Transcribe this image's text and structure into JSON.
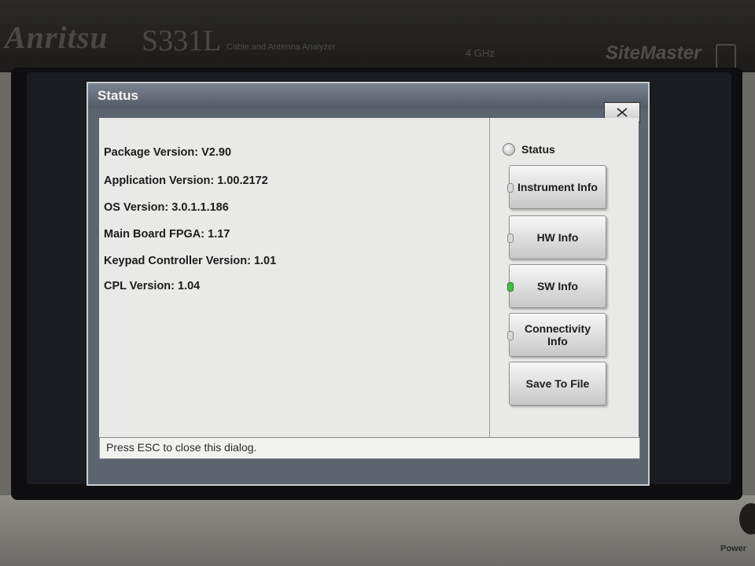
{
  "device": {
    "brand": "Anritsu",
    "model": "S331L",
    "model_description": "Cable and Antenna Analyzer",
    "frequency": "4 GHz",
    "product_name": "SiteMaster",
    "power_label": "Power"
  },
  "dialog": {
    "title": "Status",
    "close_icon": "close-icon",
    "info_lines": [
      {
        "label": "Package Version:",
        "value": "V2.90"
      },
      {
        "label": "Application Version:",
        "value": "1.00.2172"
      },
      {
        "label": "OS Version:",
        "value": "3.0.1.1.186"
      },
      {
        "label": "Main Board FPGA:",
        "value": "1.17"
      },
      {
        "label": "Keypad Controller Version:",
        "value": "1.01"
      },
      {
        "label": "CPL Version:",
        "value": "1.04"
      }
    ],
    "status_radio_label": "Status",
    "buttons": [
      {
        "label": "Instrument Info",
        "active": false
      },
      {
        "label": "HW Info",
        "active": false
      },
      {
        "label": "SW Info",
        "active": true
      },
      {
        "label": "Connectivity Info",
        "active": false
      },
      {
        "label": "Save To File",
        "active": false
      }
    ],
    "status_bar": "Press ESC to close this dialog."
  },
  "colors": {
    "active_led": "#3fbf3f"
  }
}
